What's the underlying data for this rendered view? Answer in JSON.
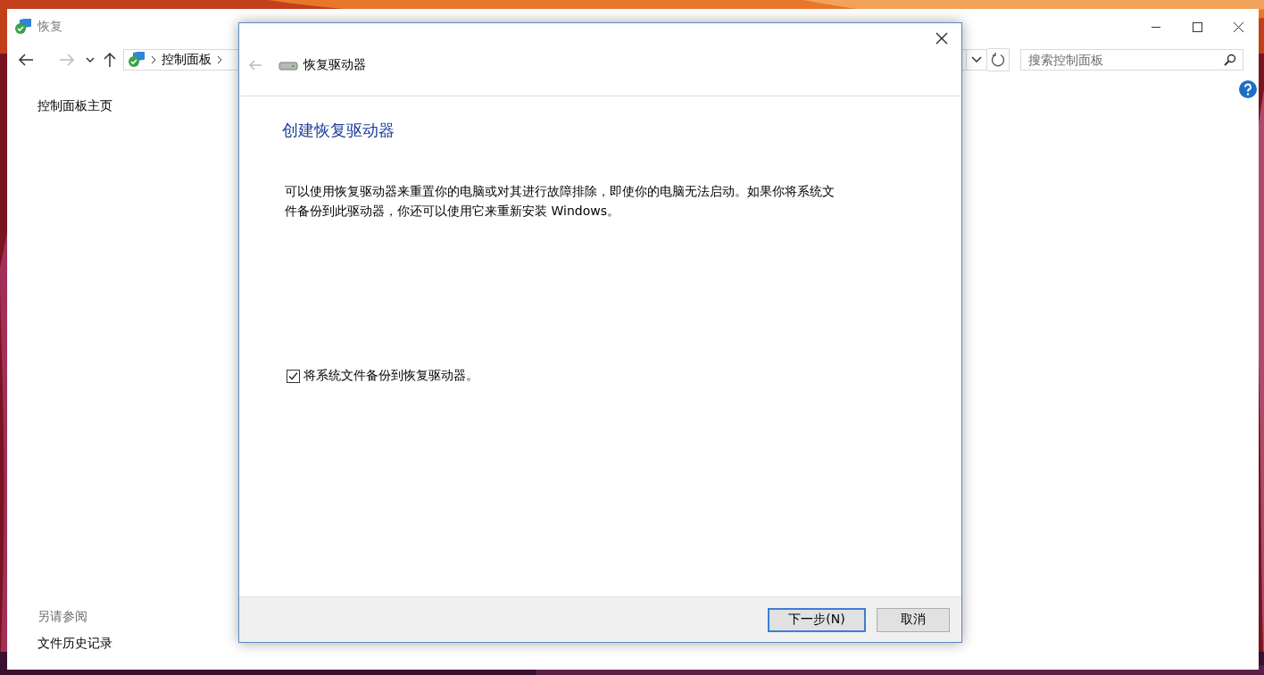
{
  "window": {
    "title": "恢复"
  },
  "navigation": {
    "address": [
      {
        "label": "控制面板"
      }
    ],
    "search": {
      "placeholder": "搜索控制面板"
    }
  },
  "sidebar": {
    "home_link": "控制面板主页",
    "see_also_heading": "另请参阅",
    "see_also_links": [
      "文件历史记录"
    ]
  },
  "dialog": {
    "header_title": "恢复驱动器",
    "back_enabled": false,
    "heading": "创建恢复驱动器",
    "description": "可以使用恢复驱动器来重置你的电脑或对其进行故障排除，即使你的电脑无法启动。如果你将系统文件备份到此驱动器，你还可以使用它来重新安装 Windows。",
    "checkbox": {
      "label": "将系统文件备份到恢复驱动器。",
      "checked": true
    },
    "buttons": [
      {
        "label": "下一步(N)",
        "default": true
      },
      {
        "label": "取消",
        "default": false
      }
    ]
  }
}
